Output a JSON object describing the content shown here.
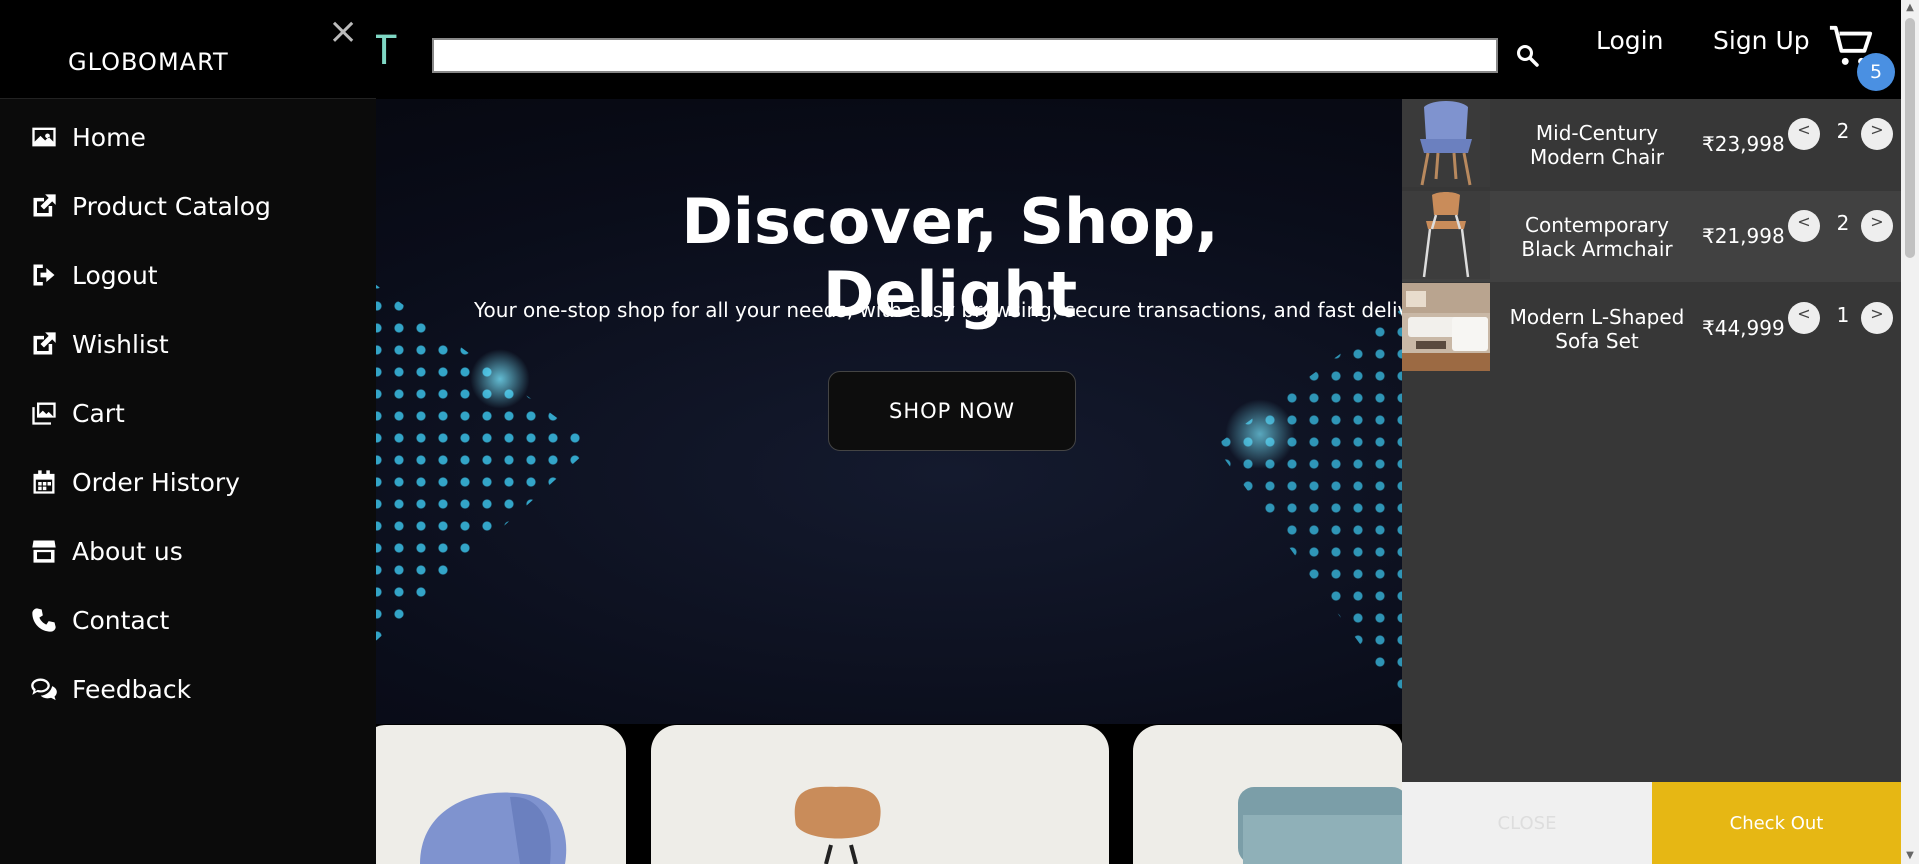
{
  "header": {
    "logo_peek": "RT",
    "search_placeholder": "",
    "login_label": "Login",
    "signup_label": "Sign Up",
    "cart_count": "5"
  },
  "hero": {
    "title": "Discover, Shop, Delight",
    "subtitle": "Your one-stop shop for all your needs, with easy browsing, secure transactions, and fast delivery.",
    "cta_label": "SHOP NOW"
  },
  "sidebar": {
    "brand": "GLOBOMART",
    "close_label": "×",
    "items": [
      {
        "label": "Home",
        "icon": "image-icon"
      },
      {
        "label": "Product Catalog",
        "icon": "external-link-icon"
      },
      {
        "label": "Logout",
        "icon": "logout-icon"
      },
      {
        "label": "Wishlist",
        "icon": "external-link-icon"
      },
      {
        "label": "Cart",
        "icon": "images-icon"
      },
      {
        "label": "Order History",
        "icon": "calendar-icon"
      },
      {
        "label": "About us",
        "icon": "store-icon"
      },
      {
        "label": "Contact",
        "icon": "phone-icon"
      },
      {
        "label": "Feedback",
        "icon": "comments-icon"
      }
    ]
  },
  "cart": {
    "items": [
      {
        "name": "Mid-Century Modern Chair",
        "price": "₹23,998",
        "qty": "2"
      },
      {
        "name": "Contemporary Black Armchair",
        "price": "₹21,998",
        "qty": "2"
      },
      {
        "name": "Modern L-Shaped Sofa Set",
        "price": "₹44,999",
        "qty": "1"
      }
    ],
    "decrement_label": "<",
    "increment_label": ">",
    "close_label": "CLOSE",
    "checkout_label": "Check Out"
  },
  "colors": {
    "accent": "#e6b714",
    "badge": "#4a90e2",
    "panel": "#373737"
  }
}
